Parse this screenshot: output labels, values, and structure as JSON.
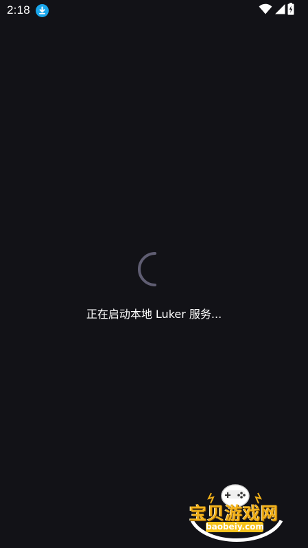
{
  "status_bar": {
    "time": "2:18",
    "icons": [
      "download-icon",
      "wifi-icon",
      "signal-icon",
      "battery-charging-icon"
    ]
  },
  "loader": {
    "message": "正在启动本地 Luker 服务..."
  },
  "watermark": {
    "brand": "宝贝游戏网",
    "url": "baobeiy.com"
  },
  "colors": {
    "background": "#121217",
    "spinner": "#5f5d72",
    "accent_download": "#1aa7ec",
    "watermark_gold": "#f3b21a"
  }
}
